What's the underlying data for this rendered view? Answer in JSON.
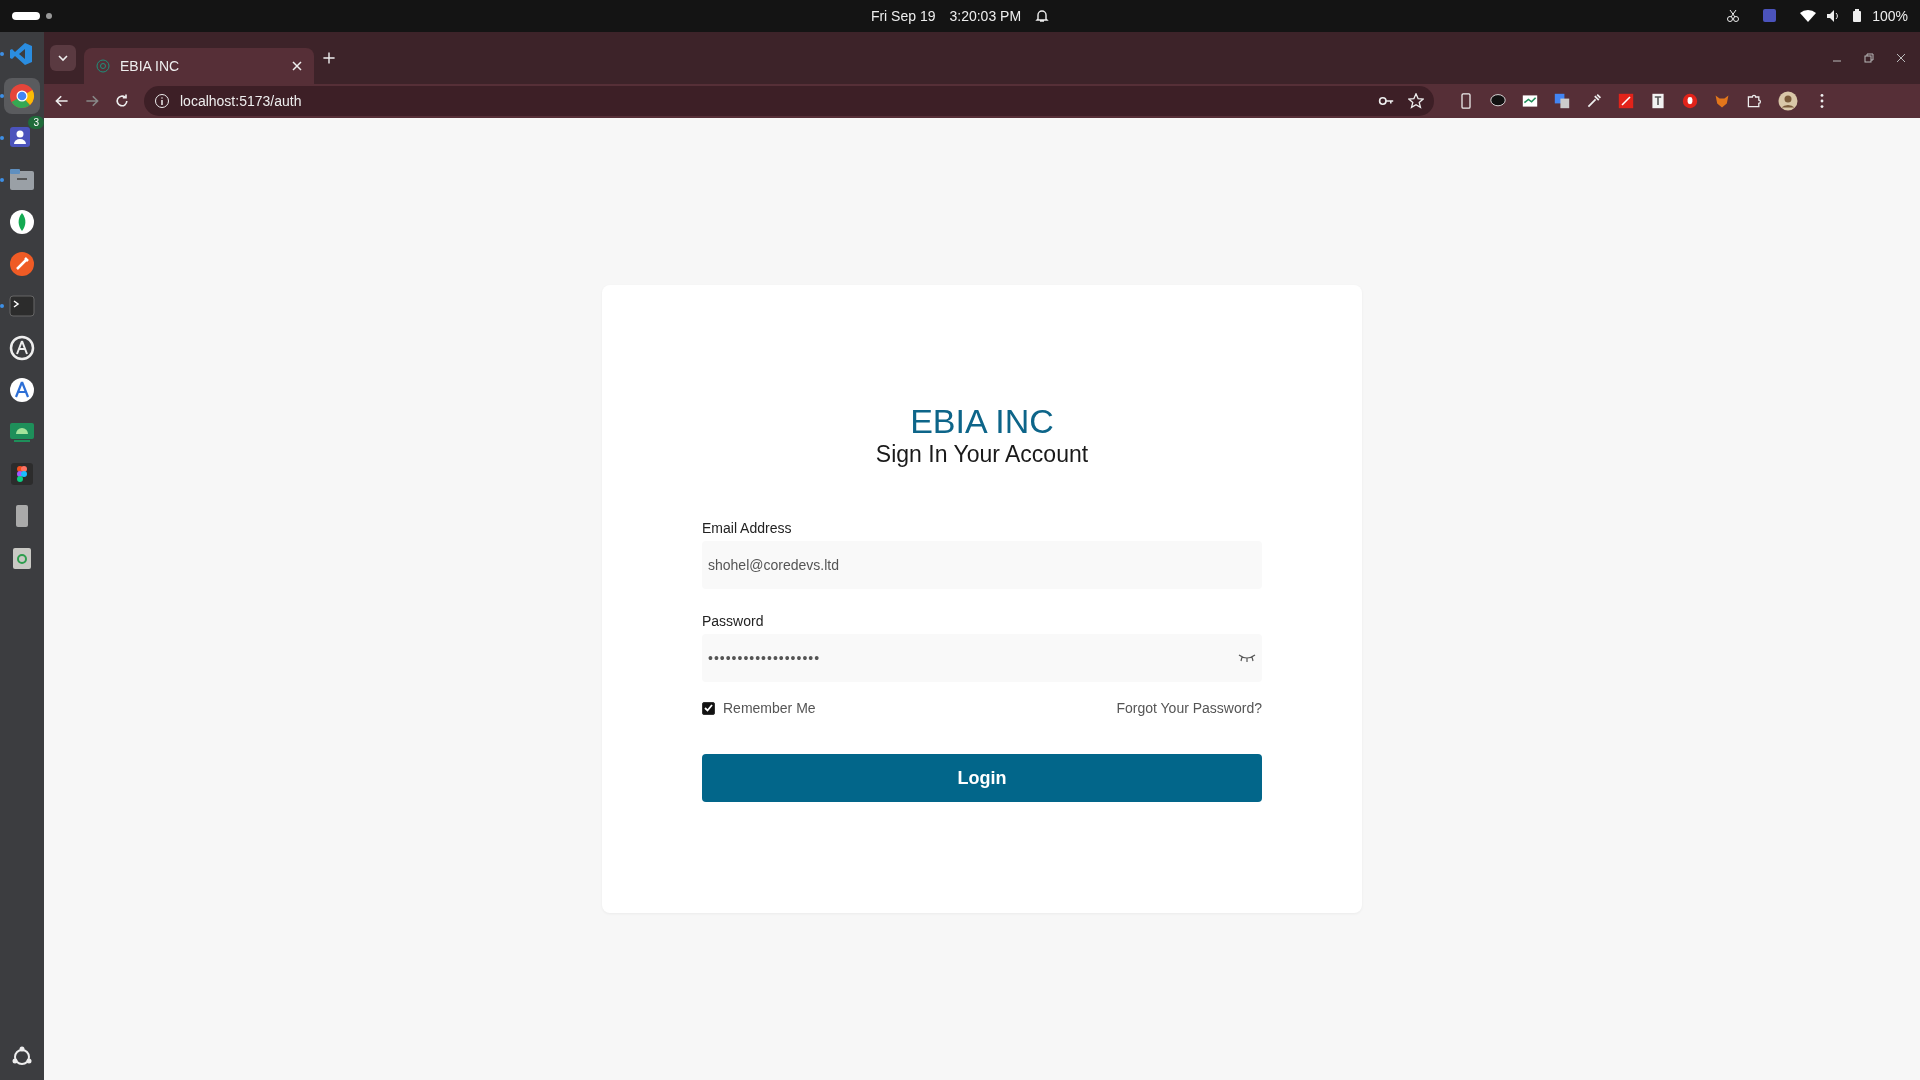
{
  "top_bar": {
    "date": "Fri Sep 19",
    "time": "3:20:03 PM",
    "battery": "100%"
  },
  "dock": [
    {
      "kind": "code",
      "running": true,
      "selected": false
    },
    {
      "kind": "browser",
      "running": true,
      "selected": true
    },
    {
      "kind": "chat",
      "running": true,
      "selected": false,
      "badge": "3"
    },
    {
      "kind": "files",
      "running": true,
      "selected": false
    },
    {
      "kind": "leaf",
      "running": false,
      "selected": false
    },
    {
      "kind": "rocket",
      "running": false,
      "selected": false
    },
    {
      "kind": "terminal",
      "running": true,
      "selected": false
    },
    {
      "kind": "updater",
      "running": false,
      "selected": false
    },
    {
      "kind": "store",
      "running": false,
      "selected": false
    },
    {
      "kind": "android",
      "running": false,
      "selected": false
    },
    {
      "kind": "design",
      "running": false,
      "selected": false
    },
    {
      "kind": "phone",
      "running": false,
      "selected": false
    },
    {
      "kind": "trash",
      "running": false,
      "selected": false
    }
  ],
  "browser": {
    "tabs": [
      {
        "title": "EBIA INC",
        "selected": true
      }
    ],
    "url": "localhost:5173/auth"
  },
  "login": {
    "company": "EBIA INC",
    "heading": "Sign In Your Account",
    "email": {
      "label": "Email Address",
      "value": "shohel@coredevs.ltd"
    },
    "password": {
      "label": "Password",
      "value": "•••••••••••••••••••"
    },
    "remember": {
      "label": "Remember Me",
      "checked": true
    },
    "forgot": "Forgot Your Password?",
    "submit": "Login"
  }
}
